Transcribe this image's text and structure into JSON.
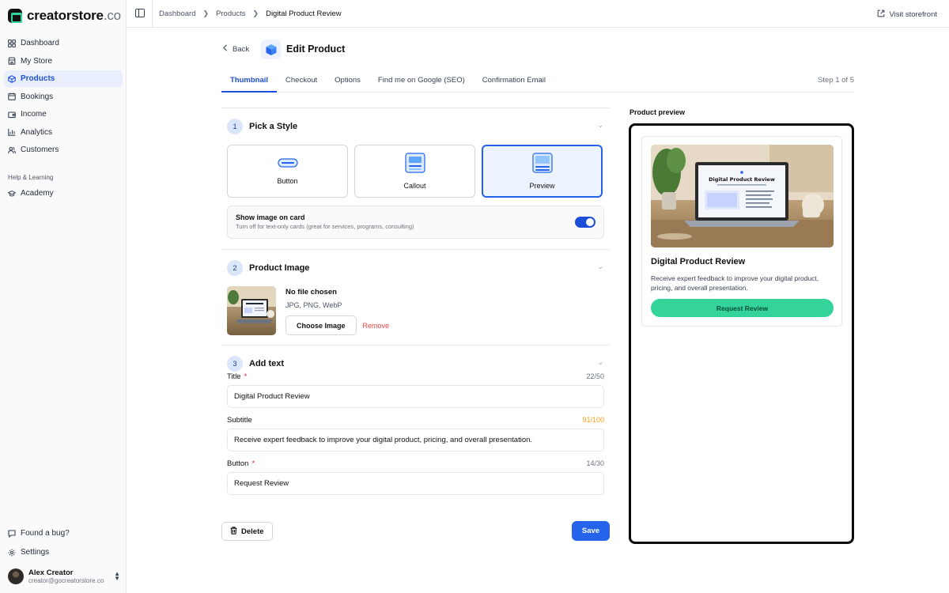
{
  "brand": {
    "name": "creatorstore",
    "tld": ".co"
  },
  "sidebar": {
    "items": [
      {
        "label": "Dashboard"
      },
      {
        "label": "My Store"
      },
      {
        "label": "Products"
      },
      {
        "label": "Bookings"
      },
      {
        "label": "Income"
      },
      {
        "label": "Analytics"
      },
      {
        "label": "Customers"
      }
    ],
    "section_label": "Help & Learning",
    "help_items": [
      {
        "label": "Academy"
      }
    ],
    "bottom_items": [
      {
        "label": "Found a bug?"
      },
      {
        "label": "Settings"
      }
    ],
    "user": {
      "name": "Alex Creator",
      "email": "creator@gocreatorstore.co"
    }
  },
  "topbar": {
    "breadcrumbs": [
      "Dashboard",
      "Products",
      "Digital Product Review"
    ],
    "visit_label": "Visit storefront"
  },
  "header": {
    "back_label": "Back",
    "title": "Edit Product"
  },
  "tabs": [
    {
      "label": "Thumbnail"
    },
    {
      "label": "Checkout"
    },
    {
      "label": "Options"
    },
    {
      "label": "Find me on Google (SEO)"
    },
    {
      "label": "Confirmation Email"
    }
  ],
  "step_label": "Step 1 of 5",
  "sections": {
    "style": {
      "number": "1",
      "title": "Pick a Style",
      "options": [
        {
          "label": "Button"
        },
        {
          "label": "Callout"
        },
        {
          "label": "Preview"
        }
      ],
      "selected": "Preview",
      "toggle": {
        "title": "Show image on card",
        "subtitle": "Turn off for text-only cards (great for services, programs, consulting)",
        "on": true
      }
    },
    "image": {
      "number": "2",
      "title": "Product Image",
      "file_status": "No file chosen",
      "formats": "JPG, PNG, WebP",
      "choose_label": "Choose Image",
      "remove_label": "Remove"
    },
    "text": {
      "number": "3",
      "title": "Add text",
      "fields": {
        "title": {
          "label": "Title",
          "required_mark": "*",
          "count": "22/50",
          "value": "Digital Product Review"
        },
        "subtitle": {
          "label": "Subtitle",
          "count": "91/100",
          "value": "Receive expert feedback to improve your digital product, pricing, and overall presentation."
        },
        "button": {
          "label": "Button",
          "required_mark": "*",
          "count": "14/30",
          "value": "Request Review"
        }
      }
    }
  },
  "actions": {
    "delete_label": "Delete",
    "save_label": "Save"
  },
  "preview": {
    "label": "Product preview",
    "card": {
      "title": "Digital Product Review",
      "subtitle": "Receive expert feedback to improve your digital product, pricing, and overall presentation.",
      "button": "Request Review",
      "screen_title": "Digital Product Review"
    }
  },
  "colors": {
    "accent": "#2563eb",
    "active_nav_bg": "#e8eefb",
    "cta_green": "#34d399",
    "warn": "#f59e0b",
    "danger": "#ef4444"
  }
}
